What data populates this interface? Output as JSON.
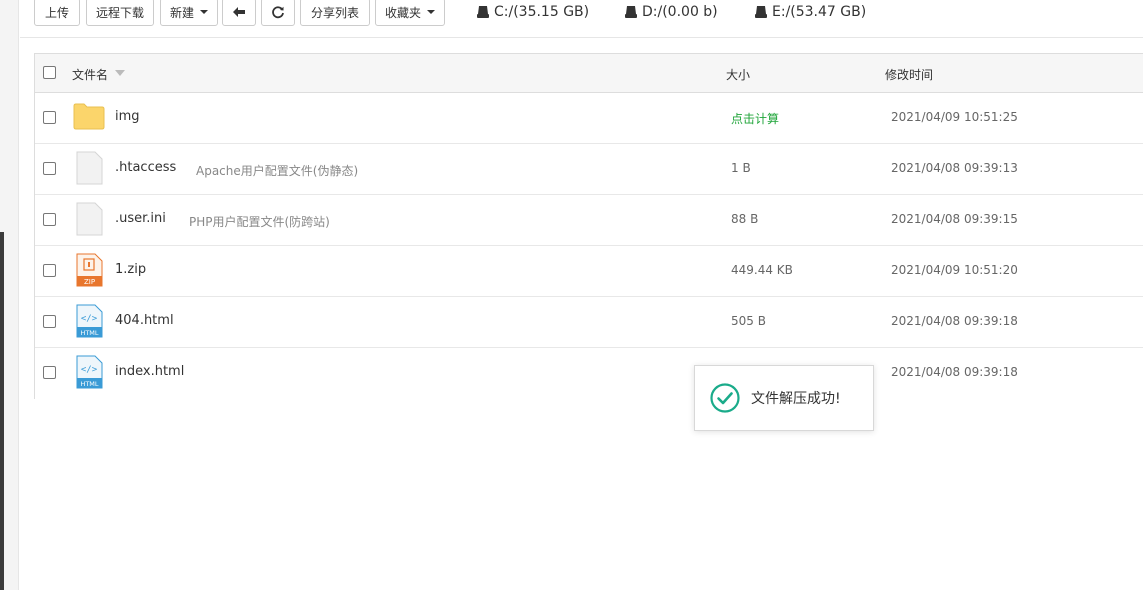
{
  "toolbar": {
    "upload": "上传",
    "remote_download": "远程下载",
    "new": "新建",
    "share_list": "分享列表",
    "favorites": "收藏夹"
  },
  "disks": [
    {
      "label": "C:/(35.15 GB)"
    },
    {
      "label": "D:/(0.00 b)"
    },
    {
      "label": "E:/(53.47 GB)"
    }
  ],
  "table": {
    "headers": {
      "name": "文件名",
      "size": "大小",
      "modified": "修改时间"
    },
    "rows": [
      {
        "name": "img",
        "desc": "",
        "size": "点击计算",
        "modified": "2021/04/09 10:51:25",
        "icon": "folder-icon"
      },
      {
        "name": ".htaccess",
        "desc": "Apache用户配置文件(伪静态)",
        "size": "1 B",
        "modified": "2021/04/08 09:39:13",
        "icon": "file-icon"
      },
      {
        "name": ".user.ini",
        "desc": "PHP用户配置文件(防跨站)",
        "size": "88 B",
        "modified": "2021/04/08 09:39:15",
        "icon": "file-icon"
      },
      {
        "name": "1.zip",
        "desc": "",
        "size": "449.44 KB",
        "modified": "2021/04/09 10:51:20",
        "icon": "zip-file-icon",
        "icon_label": "ZIP"
      },
      {
        "name": "404.html",
        "desc": "",
        "size": "505 B",
        "modified": "2021/04/08 09:39:18",
        "icon": "html-file-icon",
        "icon_label": "HTML"
      },
      {
        "name": "index.html",
        "desc": "",
        "size": "",
        "modified": "2021/04/08 09:39:18",
        "icon": "html-file-icon",
        "icon_label": "HTML"
      }
    ]
  },
  "toast": {
    "message": "文件解压成功!"
  },
  "colors": {
    "accent_green": "#20a53a",
    "toast_check": "#1aab8a",
    "zip_orange": "#e8762d",
    "html_blue": "#3a9bd6",
    "folder_yellow": "#fbd56b"
  }
}
